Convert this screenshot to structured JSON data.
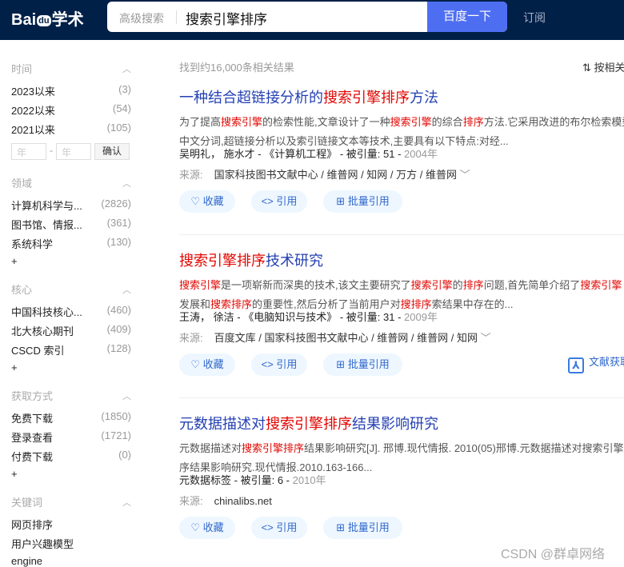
{
  "header": {
    "logo": "Baidu学术",
    "logo_paw": "du",
    "advanced_search": "高级搜索",
    "query": "搜索引擎排序",
    "search_button": "百度一下",
    "subscribe": "订阅"
  },
  "sidebar": {
    "time": {
      "title": "时间",
      "items": [
        {
          "label": "2023以来",
          "count": "(3)"
        },
        {
          "label": "2022以来",
          "count": "(54)"
        },
        {
          "label": "2021以来",
          "count": "(105)"
        }
      ],
      "from_placeholder": "年",
      "to_placeholder": "年",
      "dash": "-",
      "confirm": "确认"
    },
    "field": {
      "title": "领域",
      "items": [
        {
          "label": "计算机科学与...",
          "count": "(2826)"
        },
        {
          "label": "图书馆、情报...",
          "count": "(361)"
        },
        {
          "label": "系统科学",
          "count": "(130)"
        }
      ],
      "more": "+"
    },
    "core": {
      "title": "核心",
      "items": [
        {
          "label": "中国科技核心...",
          "count": "(460)"
        },
        {
          "label": "北大核心期刊",
          "count": "(409)"
        },
        {
          "label": "CSCD 索引",
          "count": "(128)"
        }
      ],
      "more": "+"
    },
    "access": {
      "title": "获取方式",
      "items": [
        {
          "label": "免费下载",
          "count": "(1850)"
        },
        {
          "label": "登录查看",
          "count": "(1721)"
        },
        {
          "label": "付费下载",
          "count": "(0)"
        }
      ],
      "more": "+"
    },
    "keywords": {
      "title": "关键词",
      "items": [
        {
          "label": "网页排序"
        },
        {
          "label": "用户兴趣模型"
        },
        {
          "label": "engine"
        }
      ]
    }
  },
  "main": {
    "count": "找到约16,000条相关结果",
    "sort": "按相关",
    "results": [
      {
        "title": [
          [
            "一种结合超链接分析的",
            0
          ],
          [
            "搜索引擎排序",
            1
          ],
          [
            "方法",
            0
          ]
        ],
        "line1": [
          [
            "为了提高",
            0
          ],
          [
            "搜索引擎",
            1
          ],
          [
            "的检索性能,文章设计了一种",
            0
          ],
          [
            "搜索引擎",
            1
          ],
          [
            "的综合",
            0
          ],
          [
            "排序",
            1
          ],
          [
            "方法.它采用改进的布尔检索模型",
            0
          ]
        ],
        "line2": [
          [
            "中文分词,超链接分析以及索引链接文本等技术,主要具有以下特点:对经...",
            0
          ]
        ],
        "authors": "吴明礼， 施水才",
        "journal": "《计算机工程》",
        "cite_label": "被引量:",
        "cites": "51",
        "year": "2004年",
        "source_label": "来源:",
        "sources": "国家科技图书文献中心 / 维普网 / 知网 / 万方 / 维普网"
      },
      {
        "title": [
          [
            "搜索引擎排序",
            1
          ],
          [
            "技术研究",
            0
          ]
        ],
        "line1": [
          [
            "搜索引擎",
            1
          ],
          [
            "是一项崭新而深奥的技术,该文主要研究了",
            0
          ],
          [
            "搜索引擎",
            1
          ],
          [
            "的",
            0
          ],
          [
            "排序",
            1
          ],
          [
            "问题,首先简单介绍了",
            0
          ],
          [
            "搜索引擎",
            1
          ]
        ],
        "line2": [
          [
            "发展和",
            0
          ],
          [
            "搜索排序",
            1
          ],
          [
            "的重要性,然后分析了当前用户对",
            0
          ],
          [
            "搜排序",
            1
          ],
          [
            "索结果中存在的...",
            0
          ]
        ],
        "authors": "王涛， 徐洁",
        "journal": "《电脑知识与技术》",
        "cite_label": "被引量:",
        "cites": "31",
        "year": "2009年",
        "source_label": "来源:",
        "sources": "百度文库 / 国家科技图书文献中心 / 维普网 / 维普网 / 知网",
        "pdf": "文献获取"
      },
      {
        "title": [
          [
            "元数据描述对",
            0
          ],
          [
            "搜索引擎排序",
            1
          ],
          [
            "结果影响研究",
            0
          ]
        ],
        "line1": [
          [
            "元数据描述对",
            0
          ],
          [
            "搜索引擎排序",
            1
          ],
          [
            "结果影响研究[J]. 邢博.现代情报. 2010(05)邢博.元数据描述对搜索引擎排",
            0
          ]
        ],
        "line2": [
          [
            "序结果影响研究.现代情报.2010.163-166...",
            0
          ]
        ],
        "authors": "元数据标签",
        "journal": "",
        "cite_label": "被引量:",
        "cites": "6",
        "year": "2010年",
        "source_label": "来源:",
        "sources": "chinalibs.net"
      }
    ],
    "actions": {
      "favorite": "收藏",
      "cite": "引用",
      "batch_cite": "批量引用"
    }
  },
  "watermark": "CSDN @群卓网络",
  "colors": {
    "header": "#012048",
    "button": "#4e6ef2",
    "title": "#2440b3",
    "highlight": "#e10601"
  }
}
